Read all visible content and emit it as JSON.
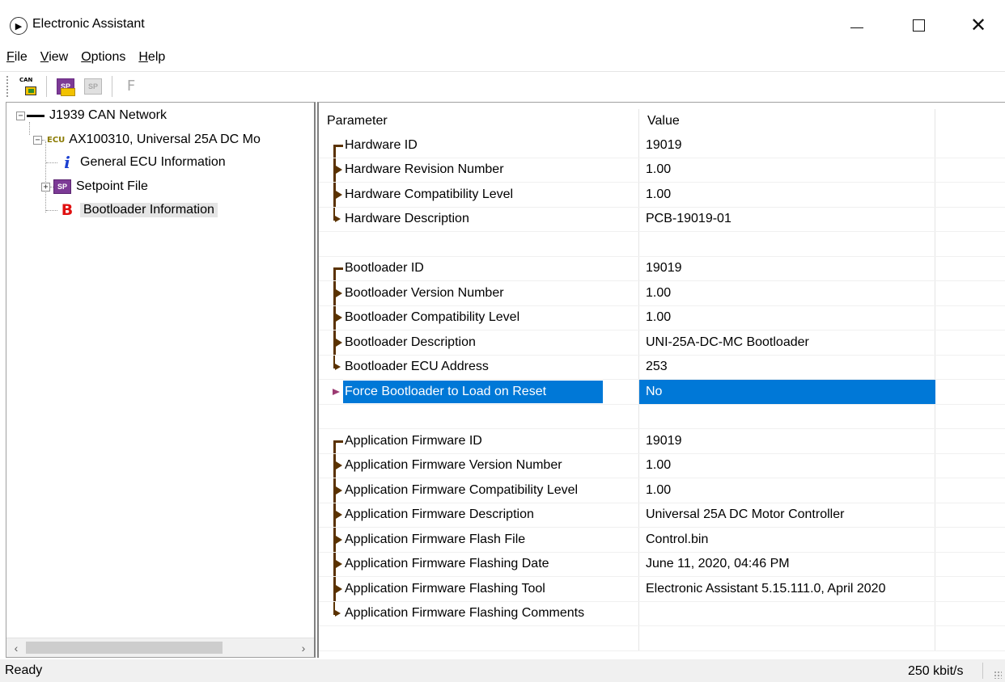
{
  "window": {
    "title": "Electronic Assistant",
    "minimize_label": "—",
    "maximize_label": "☐",
    "close_label": "✕"
  },
  "menu": [
    {
      "key": "F",
      "rest": "ile"
    },
    {
      "key": "V",
      "rest": "iew"
    },
    {
      "key": "O",
      "rest": "ptions"
    },
    {
      "key": "H",
      "rest": "elp"
    }
  ],
  "toolbar": {
    "can_icon_text": "CAN",
    "sp_open_text": "SP",
    "sp_save_text": "SP",
    "f_label": "F"
  },
  "tree": {
    "network": "J1939 CAN Network",
    "ecu_tag": "ECU",
    "ecu": "AX100310, Universal 25A DC Mo",
    "general_info_icon": "i",
    "general_info": "General ECU Information",
    "setpoint_icon": "SP",
    "setpoint": "Setpoint File",
    "bootloader_icon": "B",
    "bootloader": "Bootloader Information",
    "collapse_symbol": "−",
    "expand_symbol": "+"
  },
  "scroll": {
    "left": "‹",
    "right": "›"
  },
  "grid": {
    "columns": {
      "parameter": "Parameter",
      "value": "Value"
    },
    "rows": [
      {
        "parameter": "Hardware ID",
        "value": "19019",
        "connector": "first"
      },
      {
        "parameter": "Hardware Revision Number",
        "value": "1.00",
        "connector": "mid"
      },
      {
        "parameter": "Hardware Compatibility Level",
        "value": "1.00",
        "connector": "mid"
      },
      {
        "parameter": "Hardware Description",
        "value": "PCB-19019-01",
        "connector": "last"
      },
      {
        "parameter": "",
        "value": "",
        "connector": "none"
      },
      {
        "parameter": "Bootloader ID",
        "value": "19019",
        "connector": "first"
      },
      {
        "parameter": "Bootloader Version Number",
        "value": "1.00",
        "connector": "mid"
      },
      {
        "parameter": "Bootloader Compatibility Level",
        "value": "1.00",
        "connector": "mid"
      },
      {
        "parameter": "Bootloader Description",
        "value": "UNI-25A-DC-MC Bootloader",
        "connector": "mid"
      },
      {
        "parameter": "Bootloader ECU Address",
        "value": "253",
        "connector": "last"
      },
      {
        "parameter": "Force Bootloader to Load on Reset",
        "value": "No",
        "connector": "edit",
        "selected": true
      },
      {
        "parameter": "",
        "value": "",
        "connector": "none"
      },
      {
        "parameter": "Application Firmware ID",
        "value": "19019",
        "connector": "first"
      },
      {
        "parameter": "Application Firmware Version Number",
        "value": "1.00",
        "connector": "mid"
      },
      {
        "parameter": "Application Firmware Compatibility Level",
        "value": "1.00",
        "connector": "mid"
      },
      {
        "parameter": "Application Firmware Description",
        "value": "Universal 25A DC Motor Controller",
        "connector": "mid"
      },
      {
        "parameter": "Application Firmware Flash File",
        "value": "Control.bin",
        "connector": "mid"
      },
      {
        "parameter": "Application Firmware Flashing Date",
        "value": "June 11, 2020, 04:46 PM",
        "connector": "mid"
      },
      {
        "parameter": "Application Firmware Flashing Tool",
        "value": "Electronic Assistant 5.15.111.0, April 2020",
        "connector": "mid"
      },
      {
        "parameter": "Application Firmware Flashing Comments",
        "value": "",
        "connector": "last"
      },
      {
        "parameter": "",
        "value": "",
        "connector": "none"
      }
    ]
  },
  "status": {
    "left": "Ready",
    "right": "250 kbit/s"
  }
}
